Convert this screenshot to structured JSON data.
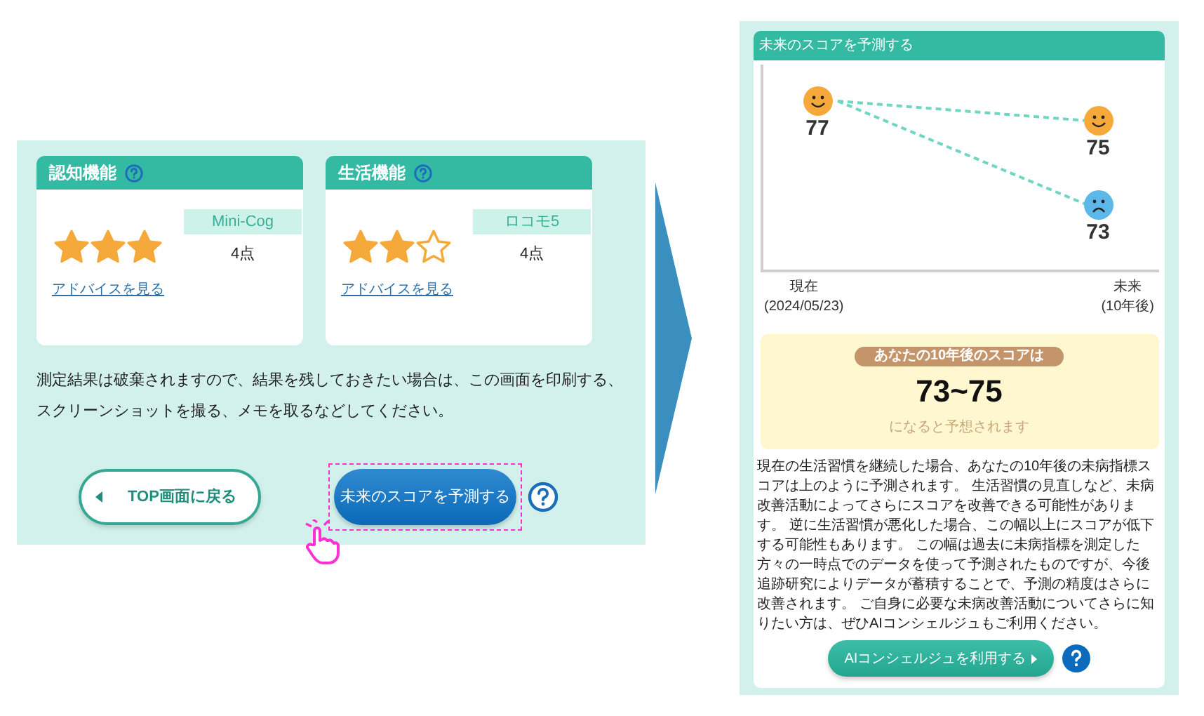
{
  "left_panel": {
    "cards": [
      {
        "title": "認知機能",
        "stars": 3,
        "test_name": "Mini-Cog",
        "score": "4点",
        "link": "アドバイスを見る"
      },
      {
        "title": "生活機能",
        "stars": 2,
        "test_name": "ロコモ5",
        "score": "4点",
        "link": "アドバイスを見る"
      }
    ],
    "notice": "測定結果は破棄されますので、結果を残しておきたい場合は、この画面を印刷する、スクリーンショットを撮る、メモを取るなどしてください。",
    "back_button": "TOP画面に戻る",
    "predict_button": "未来のスコアを予測する"
  },
  "right_panel": {
    "title": "未来のスコアを予測する",
    "forecast": {
      "columns": [
        {
          "line1": "現在",
          "line2": "(2024/05/23)",
          "points": [
            {
              "score": "77",
              "kind": "happy"
            }
          ]
        },
        {
          "line1": "未来",
          "line2": "(10年後)",
          "points": [
            {
              "score": "75",
              "kind": "happy"
            },
            {
              "score": "73",
              "kind": "sad"
            }
          ]
        }
      ]
    },
    "result": {
      "badge": "あなたの10年後のスコアは",
      "range": "73~75",
      "caption": "になると予想されます"
    },
    "description": "現在の生活習慣を継続した場合、あなたの10年後の未病指標スコアは上のように予測されます。 生活習慣の見直しなど、未病改善活動によってさらにスコアを改善できる可能性があります。 逆に生活習慣が悪化した場合、この幅以上にスコアが低下する可能性もあります。 この幅は過去に未病指標を測定した方々の一時点でのデータを使って予測されたものですが、今後追跡研究によりデータが蓄積することで、予測の精度はさらに改善されます。 ご自身に必要な未病改善活動についてさらに知りたい方は、ぜひAIコンシェルジュもご利用ください。",
    "concierge_button": "AIコンシェルジュを利用する"
  }
}
